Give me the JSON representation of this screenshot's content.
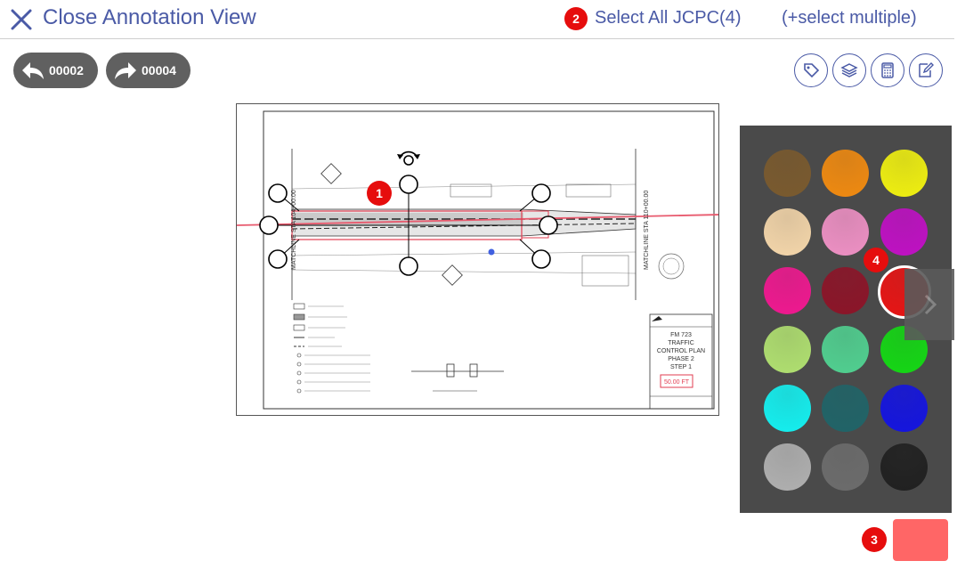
{
  "header": {
    "close_label": "Close Annotation View",
    "select_all_label": "Select All JCPC(4)",
    "select_multiple_label": "(+select multiple)"
  },
  "nav": {
    "prev_label": "00002",
    "next_label": "00004"
  },
  "toolbar": {
    "icons": [
      "tag-icon",
      "layers-icon",
      "calculator-icon",
      "edit-icon"
    ]
  },
  "badges": {
    "one": "1",
    "two": "2",
    "three": "3",
    "four": "4"
  },
  "drawing": {
    "title_block": [
      "FM 723",
      "TRAFFIC",
      "CONTROL PLAN",
      "PHASE 2",
      "STEP 1"
    ],
    "scale_label": "50.00 FT",
    "matchline_left": "MATCHLINE STA 104+00.00",
    "matchline_right": "MATCHLINE STA 110+00.00"
  },
  "palette": {
    "colors": [
      "#7a5a2e",
      "#f08a10",
      "#f0f010",
      "#f4d6aa",
      "#ee90c4",
      "#c010c4",
      "#f01890",
      "#8c1428",
      "#e81414",
      "#b0e070",
      "#50d090",
      "#14d814",
      "#14f0f0",
      "#206468",
      "#1414e0",
      "#b0b0b0",
      "#6c6c6c",
      "#202020"
    ],
    "selected_index": 8
  },
  "current_color": "#ff6666",
  "accent_color": "#4a5aa6"
}
